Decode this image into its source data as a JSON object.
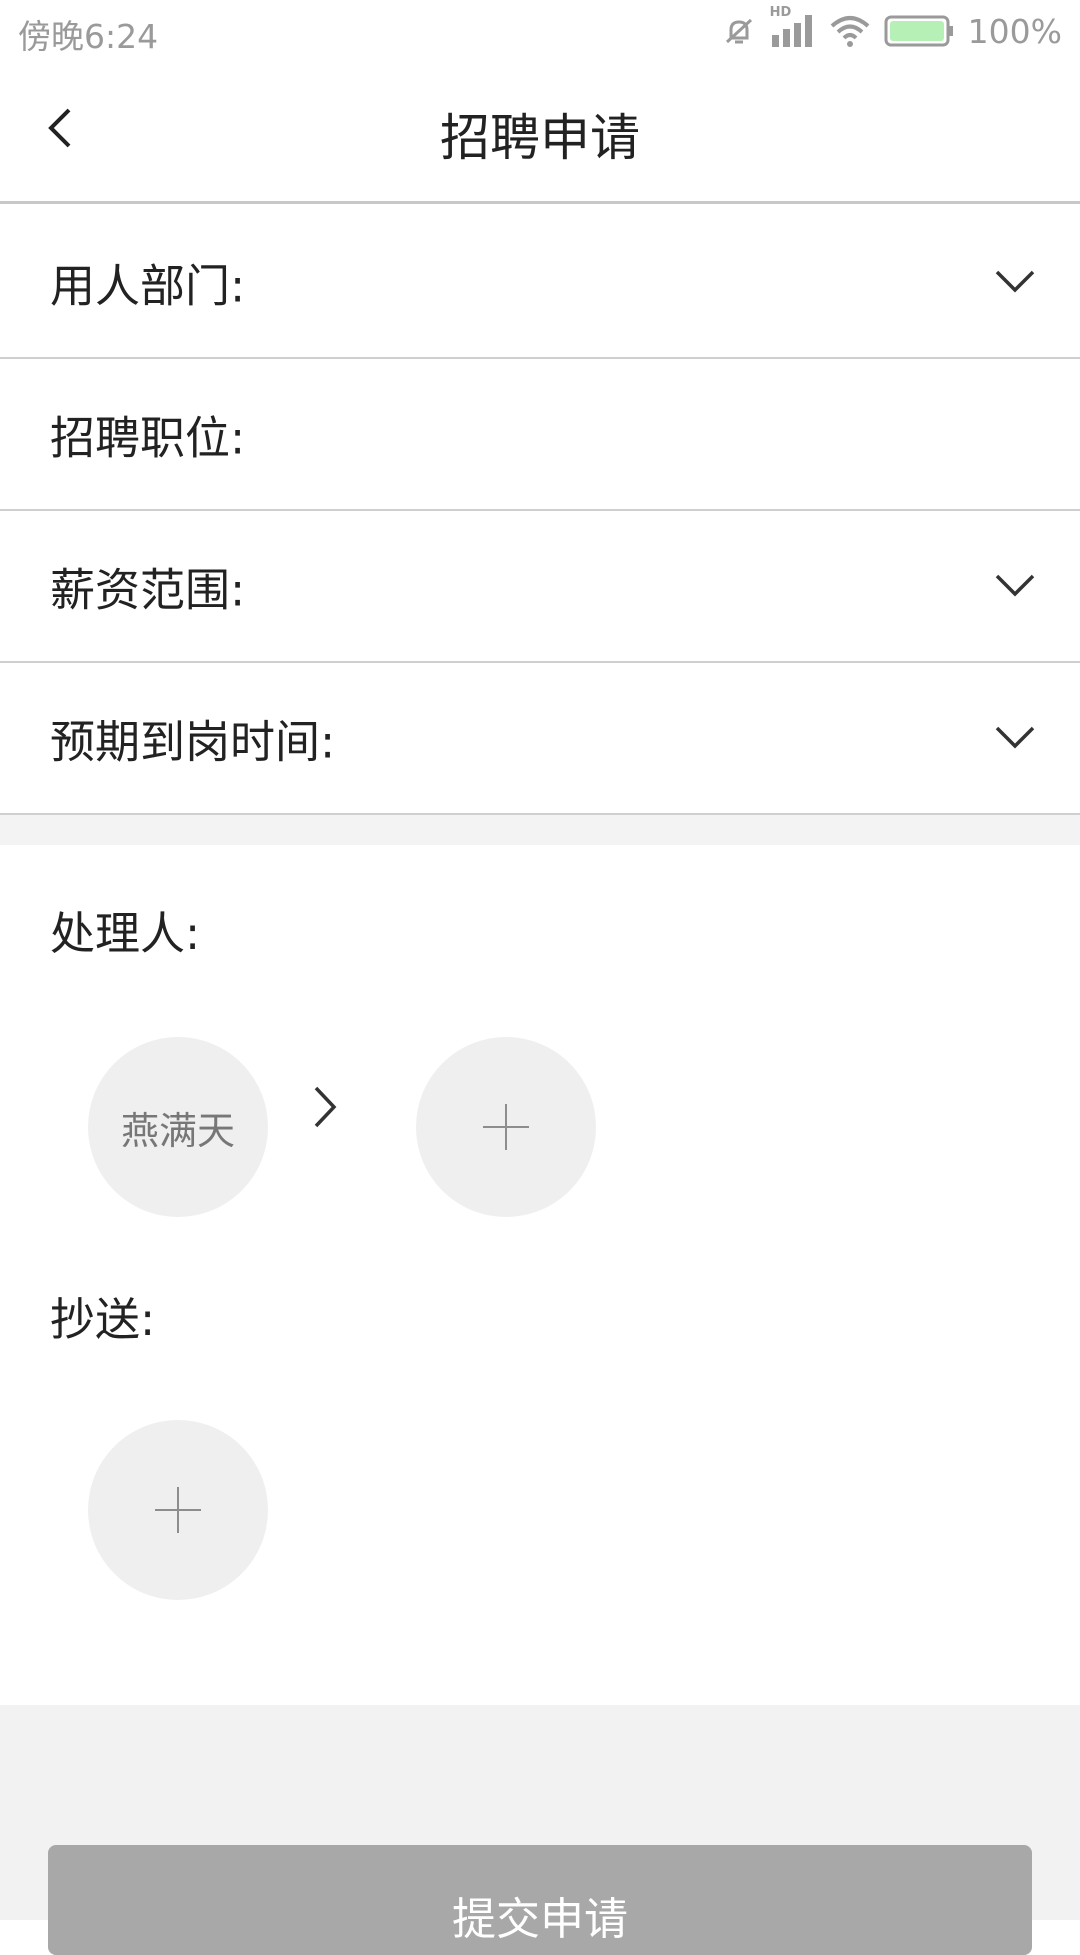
{
  "status_bar": {
    "time": "傍晚6:24",
    "battery_pct": "100%",
    "network_label": "HD"
  },
  "header": {
    "title": "招聘申请",
    "back_icon": "chevron-left-icon"
  },
  "form": {
    "rows": [
      {
        "label": "用人部门:",
        "has_dropdown": true
      },
      {
        "label": "招聘职位:",
        "has_dropdown": false
      },
      {
        "label": "薪资范围:",
        "has_dropdown": true
      },
      {
        "label": "预期到岗时间:",
        "has_dropdown": true
      }
    ]
  },
  "approvers": {
    "label": "处理人:",
    "items": [
      {
        "name": "燕满天"
      }
    ]
  },
  "cc": {
    "label": "抄送:"
  },
  "submit": {
    "label": "提交申请"
  },
  "colors": {
    "accent_disabled": "#a8a8a8",
    "avatar_bg": "#efefef",
    "battery": "#b6f0b6"
  }
}
